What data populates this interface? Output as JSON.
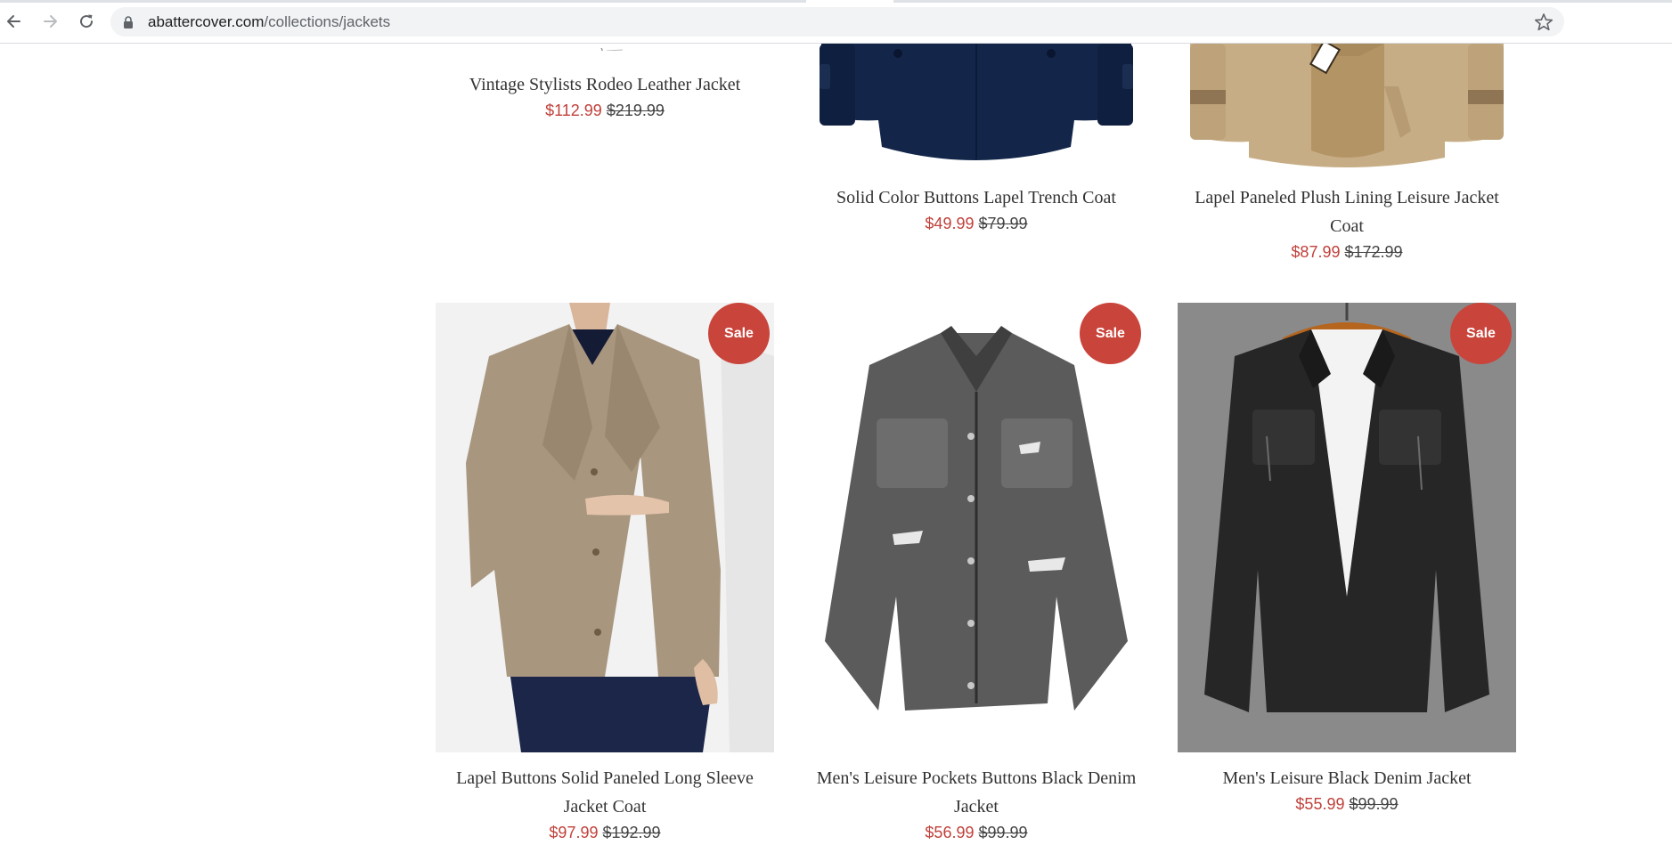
{
  "browser": {
    "url_domain": "abattercover.com",
    "url_path": "/collections/jackets"
  },
  "products_top": [
    {
      "title": "Vintage Stylists Rodeo Leather Jacket",
      "sale_price": "$112.99",
      "original_price": "$219.99"
    },
    {
      "title": "Solid Color Buttons Lapel Trench Coat",
      "sale_price": "$49.99",
      "original_price": "$79.99"
    },
    {
      "title": "Lapel Paneled Plush Lining Leisure Jacket Coat",
      "sale_price": "$87.99",
      "original_price": "$172.99"
    }
  ],
  "products_bottom": [
    {
      "badge": "Sale",
      "title": "Lapel Buttons Solid Paneled Long Sleeve Jacket Coat",
      "sale_price": "$97.99",
      "original_price": "$192.99"
    },
    {
      "badge": "Sale",
      "title": "Men's Leisure Pockets Buttons Black Denim Jacket",
      "sale_price": "$56.99",
      "original_price": "$99.99"
    },
    {
      "badge": "Sale",
      "title": "Men's Leisure Black Denim Jacket",
      "sale_price": "$55.99",
      "original_price": "$99.99"
    }
  ],
  "colors": {
    "sale_price": "#c0413b",
    "badge": "#c9443b",
    "omnibox": "#f1f3f4"
  },
  "icons": [
    "back-arrow-icon",
    "forward-arrow-icon",
    "reload-icon",
    "lock-icon",
    "star-icon"
  ]
}
